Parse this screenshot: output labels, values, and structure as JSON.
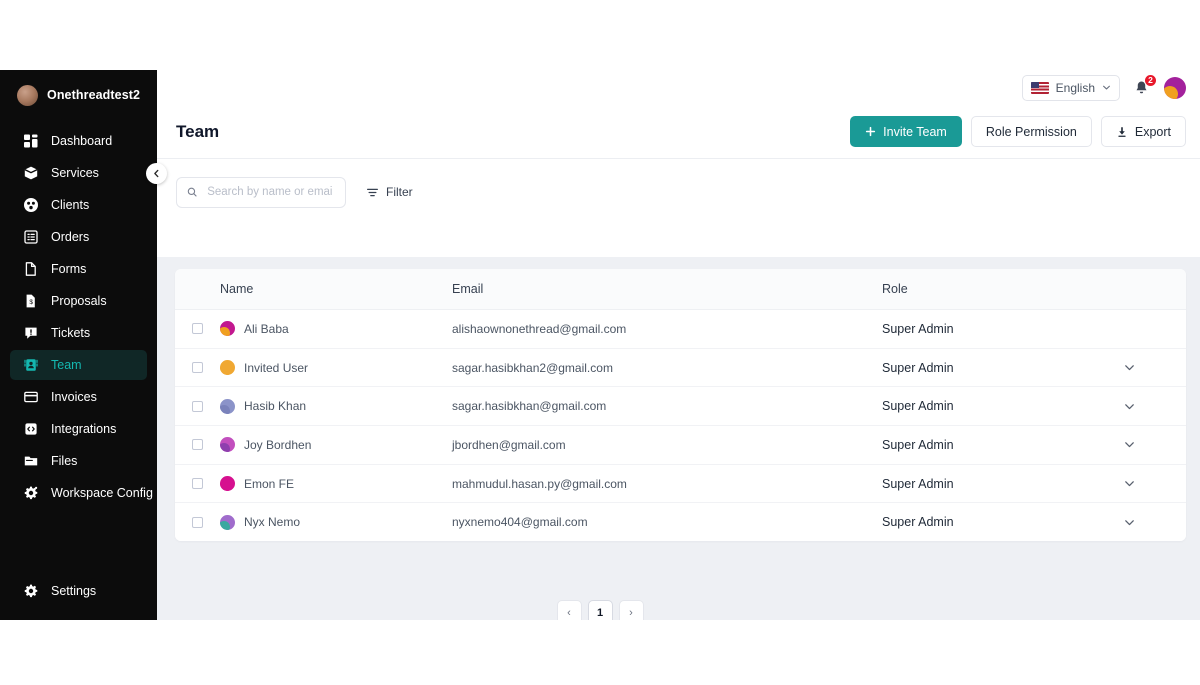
{
  "sidebar": {
    "brand": {
      "name": "Onethreadtest2",
      "avatar_icon": "user-avatar"
    },
    "collapse_icon": "chevron-left-icon",
    "items": [
      {
        "label": "Dashboard",
        "icon": "dashboard-icon",
        "active": false
      },
      {
        "label": "Services",
        "icon": "box-icon",
        "active": false
      },
      {
        "label": "Clients",
        "icon": "people-circle-icon",
        "active": false
      },
      {
        "label": "Orders",
        "icon": "list-icon",
        "active": false
      },
      {
        "label": "Forms",
        "icon": "document-icon",
        "active": false
      },
      {
        "label": "Proposals",
        "icon": "proposal-icon",
        "active": false
      },
      {
        "label": "Tickets",
        "icon": "ticket-icon",
        "active": false
      },
      {
        "label": "Team",
        "icon": "team-icon",
        "active": true
      },
      {
        "label": "Invoices",
        "icon": "invoice-icon",
        "active": false
      },
      {
        "label": "Integrations",
        "icon": "integrations-icon",
        "active": false
      },
      {
        "label": "Files",
        "icon": "folder-icon",
        "active": false
      },
      {
        "label": "Workspace Config",
        "icon": "gear-sparkle-icon",
        "active": false
      }
    ],
    "settings": {
      "label": "Settings",
      "icon": "gear-icon"
    },
    "active_color": "#14b8b0"
  },
  "topbar": {
    "language": {
      "label": "English",
      "flag": "us-flag-icon",
      "chevron": "chevron-down-icon"
    },
    "notifications": {
      "icon": "bell-icon",
      "count": "2",
      "badge_color": "#e8182b"
    },
    "avatar_icon": "user-avatar"
  },
  "page": {
    "title": "Team",
    "actions": {
      "invite": {
        "label": "Invite Team",
        "icon": "plus-icon",
        "color": "#1a9a96"
      },
      "role_permission": {
        "label": "Role Permission"
      },
      "export": {
        "label": "Export",
        "icon": "download-icon"
      }
    },
    "search": {
      "placeholder": "Search by name or email",
      "value": "",
      "icon": "search-icon"
    },
    "filter": {
      "label": "Filter",
      "icon": "filter-icon"
    }
  },
  "table": {
    "columns": [
      "Name",
      "Email",
      "Role"
    ],
    "rows": [
      {
        "name": "Ali Baba",
        "email": "alishaownonethread@gmail.com",
        "role": "Super Admin",
        "avatar_color": "#c2188f",
        "avatar_accent": "#f0a020",
        "has_chevron": false
      },
      {
        "name": "Invited User",
        "email": "sagar.hasibkhan2@gmail.com",
        "role": "Super Admin",
        "avatar_color": "#f0a832",
        "avatar_accent": "#f0a832",
        "has_chevron": true
      },
      {
        "name": "Hasib Khan",
        "email": "sagar.hasibkhan@gmail.com",
        "role": "Super Admin",
        "avatar_color": "#8b93c9",
        "avatar_accent": "#7a82bb",
        "has_chevron": true
      },
      {
        "name": "Joy Bordhen",
        "email": "jbordhen@gmail.com",
        "role": "Super Admin",
        "avatar_color": "#c24fbe",
        "avatar_accent": "#8e3fae",
        "has_chevron": true
      },
      {
        "name": "Emon FE",
        "email": "mahmudul.hasan.py@gmail.com",
        "role": "Super Admin",
        "avatar_color": "#d6108f",
        "avatar_accent": "#d6108f",
        "has_chevron": true
      },
      {
        "name": "Nyx Nemo",
        "email": "nyxnemo404@gmail.com",
        "role": "Super Admin",
        "avatar_color": "#a06ccc",
        "avatar_accent": "#3aa8a0",
        "has_chevron": true
      }
    ]
  },
  "pagination": {
    "prev": "‹",
    "current": "1",
    "next": "›"
  },
  "watermark": {
    "icon": "onethread-logo",
    "color": "#7a1ef0"
  }
}
